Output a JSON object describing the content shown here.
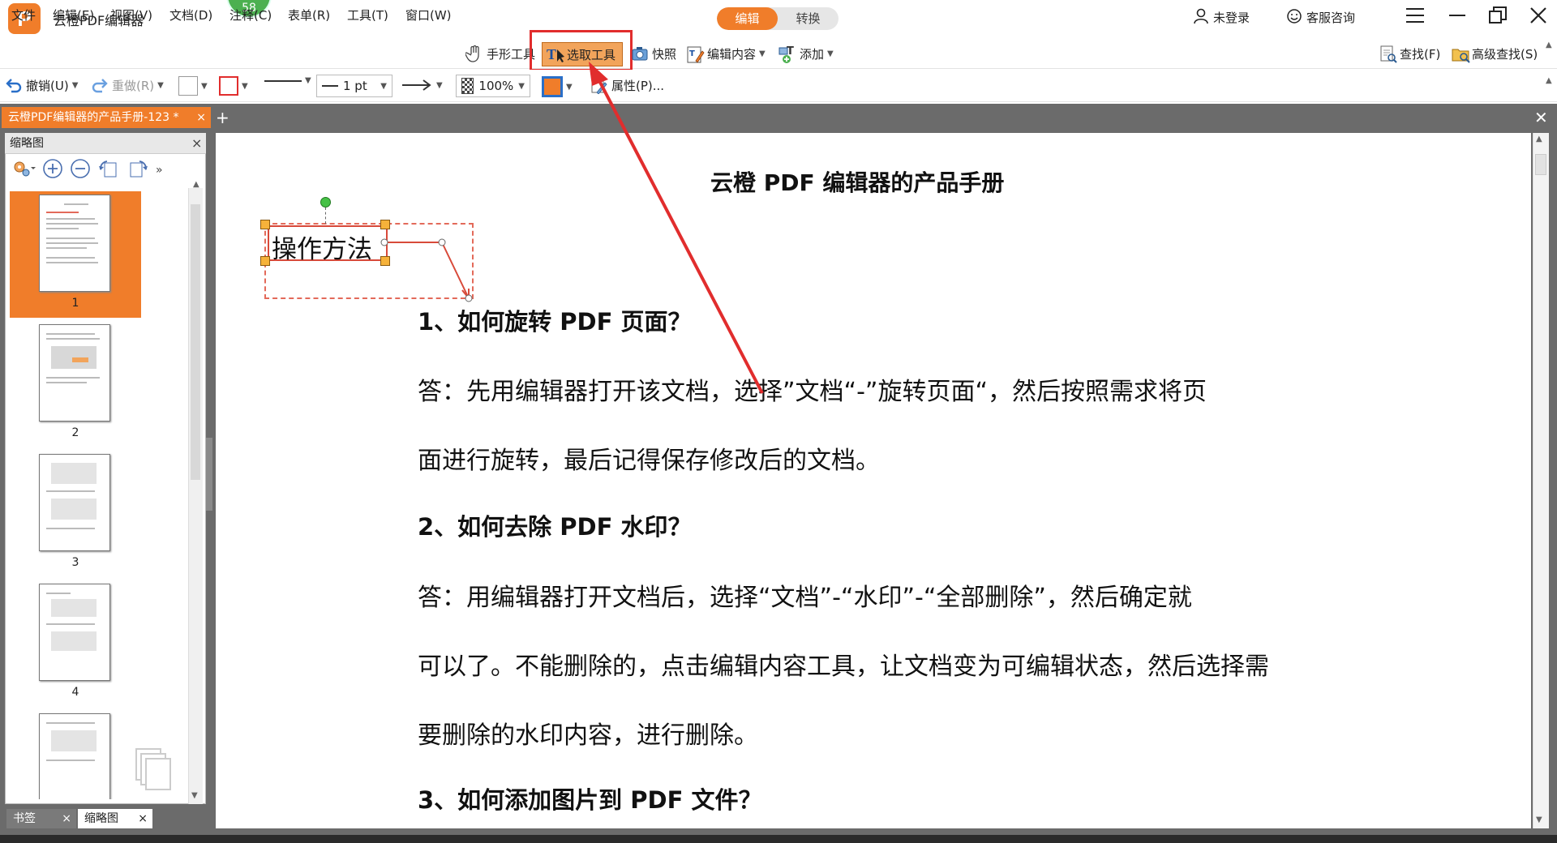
{
  "window": {
    "title": "云橙PDF编辑器",
    "logo_letter": "P",
    "badge": "58",
    "modes": [
      "编辑",
      "转换"
    ],
    "login": "未登录",
    "service": "客服咨询"
  },
  "menu": {
    "items": [
      "文件",
      "编辑(E)",
      "视图(V)",
      "文档(D)",
      "注释(C)",
      "表单(R)",
      "工具(T)",
      "窗口(W)"
    ],
    "tools": {
      "hand": "手形工具",
      "select": "选取工具",
      "snapshot": "快照",
      "edit_content": "编辑内容",
      "add": "添加"
    },
    "find": "查找(F)",
    "advanced_find": "高级查找(S)"
  },
  "toolbar": {
    "undo": "撤销(U)",
    "redo": "重做(R)",
    "line_width": "1 pt",
    "opacity": "100%",
    "properties": "属性(P)..."
  },
  "tabs": {
    "document": "云橙PDF编辑器的产品手册-123 *",
    "close_glyph": "×"
  },
  "thumbnail_panel": {
    "title": "缩略图",
    "pages": [
      "1",
      "2",
      "3",
      "4"
    ],
    "bottom_tabs": [
      "书签",
      "缩略图"
    ]
  },
  "document": {
    "title": "云橙 PDF 编辑器的产品手册",
    "annotation_text": "操作方法",
    "q1": "1、如何旋转  PDF  页面？",
    "a1_line1": "答：先用编辑器打开该文档，选择”文档“-”旋转页面“，然后按照需求将页",
    "a1_line2": "面进行旋转，最后记得保存修改后的文档。",
    "q2": "2、如何去除  PDF  水印？",
    "a2_line1": "答：用编辑器打开文档后，选择“文档”-“水印”-“全部删除”，然后确定就",
    "a2_line2": "可以了。不能删除的，点击编辑内容工具，让文档变为可编辑状态，然后选择需",
    "a2_line3": "要删除的水印内容，进行删除。",
    "q3": "3、如何添加图片到  PDF  文件？"
  },
  "colors": {
    "accent": "#f07d2a",
    "highlight": "#e12d2d"
  }
}
